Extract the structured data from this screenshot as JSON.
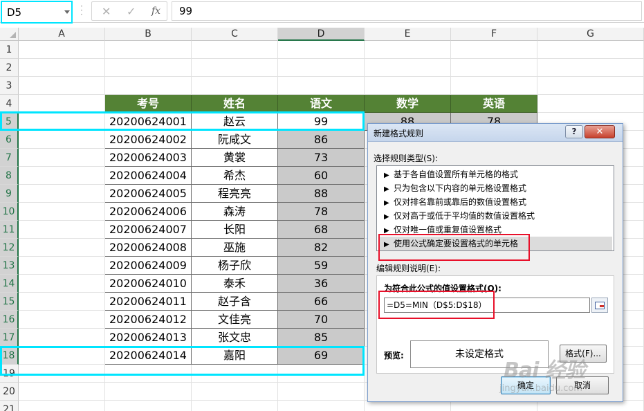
{
  "formula_bar": {
    "name_box": "D5",
    "cancel_glyph": "✕",
    "enter_glyph": "✓",
    "fx_label": "fx",
    "formula_value": "99"
  },
  "sheet": {
    "col_headers": [
      "A",
      "B",
      "C",
      "D",
      "E",
      "F",
      "G"
    ],
    "row_headers": [
      "1",
      "2",
      "3",
      "4",
      "5",
      "6",
      "7",
      "8",
      "9",
      "10",
      "11",
      "12",
      "13",
      "14",
      "15",
      "16",
      "17",
      "18",
      "19",
      "20",
      "21"
    ],
    "table_headers": [
      "考号",
      "姓名",
      "语文",
      "数学",
      "英语"
    ],
    "rows": [
      {
        "id": "20200624001",
        "name": "赵云",
        "chinese": "99",
        "math": "88",
        "english": "78"
      },
      {
        "id": "20200624002",
        "name": "阮咸文",
        "chinese": "86"
      },
      {
        "id": "20200624003",
        "name": "黄裳",
        "chinese": "73"
      },
      {
        "id": "20200624004",
        "name": "希杰",
        "chinese": "60"
      },
      {
        "id": "20200624005",
        "name": "程亮亮",
        "chinese": "88"
      },
      {
        "id": "20200624006",
        "name": "森涛",
        "chinese": "78"
      },
      {
        "id": "20200624007",
        "name": "长阳",
        "chinese": "68"
      },
      {
        "id": "20200624008",
        "name": "巫施",
        "chinese": "82"
      },
      {
        "id": "20200624009",
        "name": "杨子欣",
        "chinese": "59"
      },
      {
        "id": "20200624010",
        "name": "泰禾",
        "chinese": "36"
      },
      {
        "id": "20200624011",
        "name": "赵子含",
        "chinese": "66"
      },
      {
        "id": "20200624012",
        "name": "文佳亮",
        "chinese": "70"
      },
      {
        "id": "20200624013",
        "name": "张文忠",
        "chinese": "85"
      },
      {
        "id": "20200624014",
        "name": "嘉阳",
        "chinese": "69"
      }
    ]
  },
  "dialog": {
    "title": "新建格式规则",
    "help_glyph": "?",
    "close_glyph": "✕",
    "rule_type_label": "选择规则类型(S):",
    "rule_arrow": "▶",
    "rule_types": [
      "基于各自值设置所有单元格的格式",
      "只为包含以下内容的单元格设置格式",
      "仅对排名靠前或靠后的数值设置格式",
      "仅对高于或低于平均值的数值设置格式",
      "仅对唯一值或重复值设置格式",
      "使用公式确定要设置格式的单元格"
    ],
    "selected_rule_index": 5,
    "desc_label": "编辑规则说明(E):",
    "formula_label": "为符合此公式的值设置格式(O):",
    "formula": "=D5=MIN（D$5:D$18）",
    "preview_label": "预览:",
    "preview_text": "未设定格式",
    "format_button": "格式(F)...",
    "ok_button": "确定",
    "cancel_button": "取消"
  },
  "watermark": {
    "main": "Bai 经验",
    "sub": "jingyan.baidu.com"
  },
  "colors": {
    "header_green": "#548235",
    "selection_cyan": "#00e5ff",
    "annotation_red": "#e8102a",
    "shade_gray": "#cacaca"
  }
}
